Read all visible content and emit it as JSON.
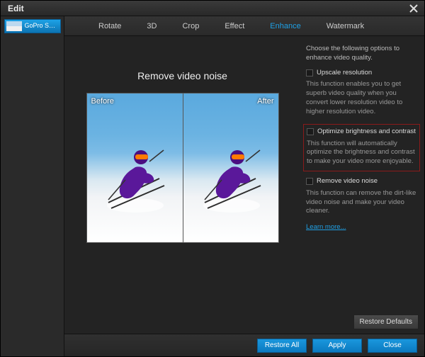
{
  "window": {
    "title": "Edit"
  },
  "sidebar": {
    "items": [
      {
        "label": "GoPro Swim..."
      }
    ]
  },
  "tabs": [
    {
      "label": "Rotate"
    },
    {
      "label": "3D"
    },
    {
      "label": "Crop"
    },
    {
      "label": "Effect"
    },
    {
      "label": "Enhance",
      "active": true
    },
    {
      "label": "Watermark"
    }
  ],
  "preview": {
    "title": "Remove video noise",
    "before_label": "Before",
    "after_label": "After"
  },
  "options": {
    "intro": "Choose the following options to enhance video quality.",
    "upscale": {
      "label": "Upscale resolution",
      "desc": "This function enables you to get superb video quality when you convert lower resolution video to higher resolution video."
    },
    "optimize": {
      "label": "Optimize brightness and contrast",
      "desc": "This function will automatically optimize the brightness and contrast to make your video more enjoyable."
    },
    "denoise": {
      "label": "Remove video noise",
      "desc": "This function can remove the dirt-like video noise and make your video cleaner."
    },
    "learn_more": "Learn more..."
  },
  "buttons": {
    "restore_defaults": "Restore Defaults",
    "restore_all": "Restore All",
    "apply": "Apply",
    "close": "Close"
  }
}
